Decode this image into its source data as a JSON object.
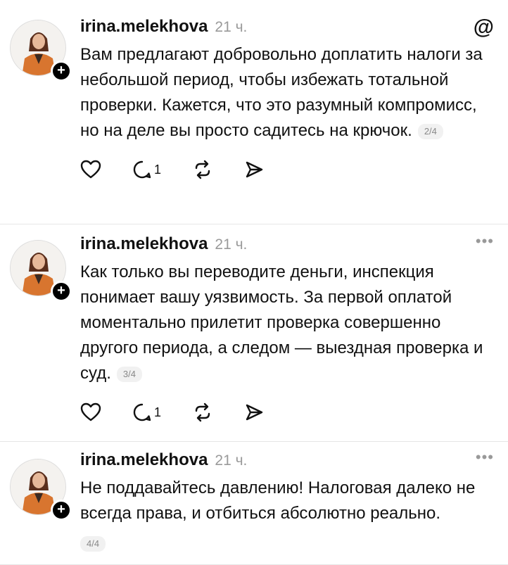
{
  "posts": [
    {
      "username": "irina.melekhova",
      "time": "21 ч.",
      "text": "Вам предлагают добровольно доплатить налоги за небольшой период, чтобы избежать тотальной проверки. Кажется, что это разумный компромисс, но на деле вы просто садитесь на крючок.",
      "counter": "2/4",
      "reply_count": "1"
    },
    {
      "username": "irina.melekhova",
      "time": "21 ч.",
      "text": "Как только вы переводите деньги, инспекция понимает вашу уязвимость. За первой оплатой моментально прилетит проверка совершенно другого периода, а следом — выездная проверка и суд.",
      "counter": "3/4",
      "reply_count": "1"
    },
    {
      "username": "irina.melekhova",
      "time": "21 ч.",
      "text": "Не поддавайтесь давлению! Налоговая далеко не всегда права, и отбиться абсолютно реально.",
      "counter": "4/4"
    }
  ],
  "icons": {
    "threads_logo": "threads-logo-icon",
    "more": "more-icon",
    "like": "heart-icon",
    "reply": "comment-icon",
    "repost": "repost-icon",
    "share": "send-icon",
    "follow": "plus-icon"
  },
  "colors": {
    "jacket": "#d8752f",
    "muted_text": "#9a9a9a"
  }
}
